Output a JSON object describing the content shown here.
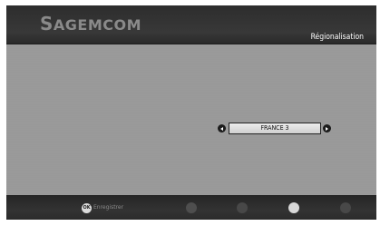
{
  "header": {
    "logo": "Sagemcom",
    "logo_cap_first": "S",
    "logo_rest": "AGEMCOM",
    "title": "Régionalisation"
  },
  "main": {
    "selector": {
      "value": "FRANCE 3",
      "left_icon": "left-arrow-icon",
      "right_icon": "right-arrow-icon"
    }
  },
  "footer": {
    "ok_icon_text": "OK",
    "ok_label": "Enregistrer",
    "color_buttons": [
      "red-button",
      "green-button",
      "yellow-button",
      "blue-button"
    ]
  }
}
